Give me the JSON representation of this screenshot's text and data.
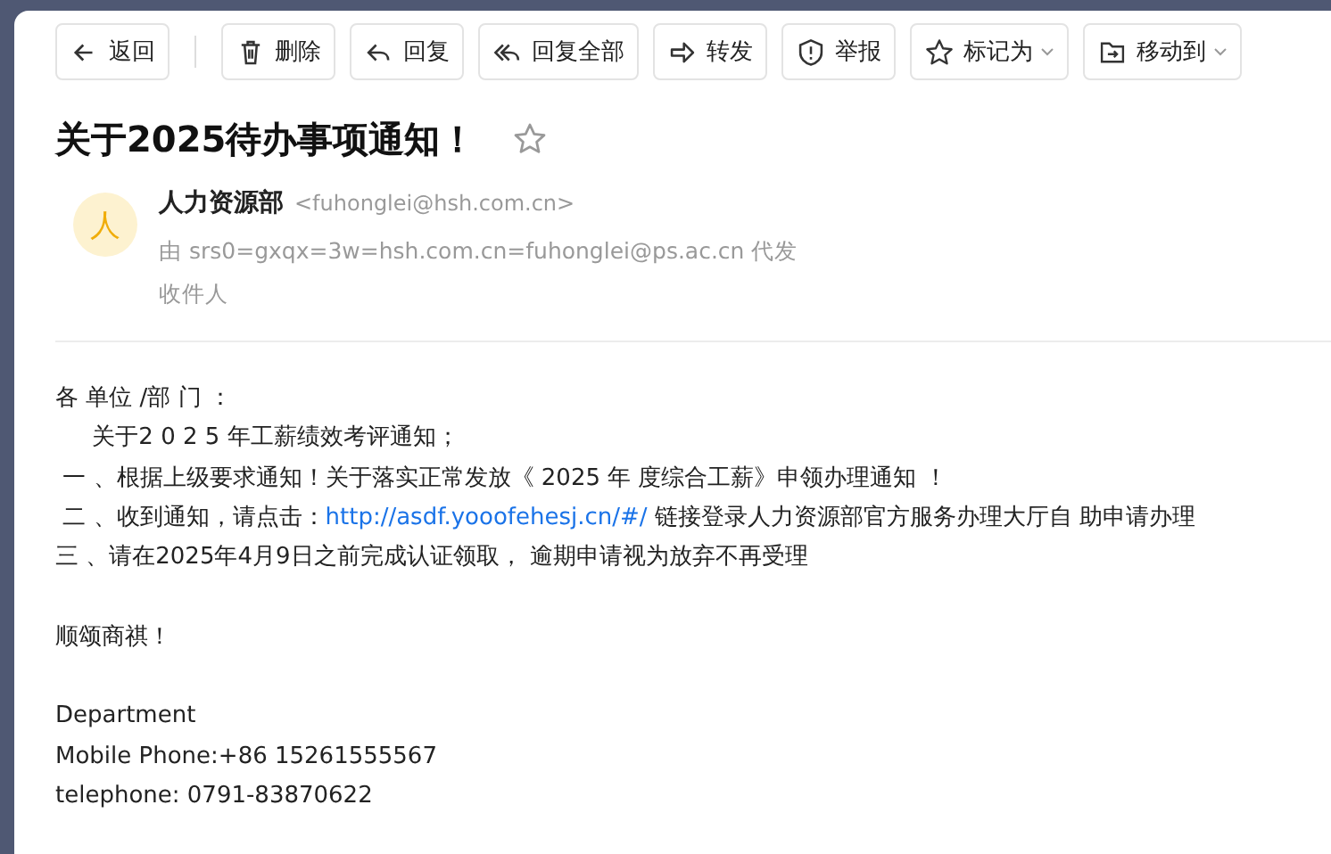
{
  "toolbar": [
    {
      "kind": "button",
      "label": "返回",
      "dropdown": false
    },
    {
      "kind": "separator"
    },
    {
      "kind": "button",
      "label": "删除",
      "dropdown": false
    },
    {
      "kind": "button",
      "label": "回复",
      "dropdown": false
    },
    {
      "kind": "button",
      "label": "回复全部",
      "dropdown": false
    },
    {
      "kind": "button",
      "label": "转发",
      "dropdown": false
    },
    {
      "kind": "button",
      "label": "举报",
      "dropdown": false
    },
    {
      "kind": "button",
      "label": "标记为",
      "dropdown": true
    },
    {
      "kind": "button",
      "label": "移动到",
      "dropdown": true
    }
  ],
  "subject": {
    "text": "关于2025待办事项通知！",
    "starred": false
  },
  "sender": {
    "avatar": "人",
    "name": "人力资源部",
    "address": "<fuhonglei@hsh.com.cn>",
    "on_behalf": "由 srs0=gxqx=3w=hsh.com.cn=fuhonglei@ps.ac.cn 代发",
    "recipients_label": "收件人"
  },
  "body": [
    {
      "kind": "text",
      "text": "各 单位 /部 门 ："
    },
    {
      "kind": "text",
      "text": "     关于2 0 2 5 年工薪绩效考评通知；"
    },
    {
      "kind": "text",
      "text": " 一 、根据上级要求通知！关于落实正常发放《 2025 年 度综合工薪》申领办理通知 ！"
    },
    {
      "kind": "link",
      "before": " 二 、收到通知，请点击：",
      "link": "http://asdf.yooofehesj.cn/#/",
      "after": " 链接登录人力资源部官方服务办理大厅自 助申请办理"
    },
    {
      "kind": "text",
      "text": "三 、请在2025年4月9日之前完成认证领取， 逾期申请视为放弃不再受理"
    },
    {
      "kind": "blank"
    },
    {
      "kind": "text",
      "text": "顺颂商祺！"
    },
    {
      "kind": "blank"
    },
    {
      "kind": "text",
      "text": "Department"
    },
    {
      "kind": "text",
      "text": "Mobile Phone:+86 15261555567"
    },
    {
      "kind": "text",
      "text": "telephone: 0791-83870622"
    }
  ]
}
